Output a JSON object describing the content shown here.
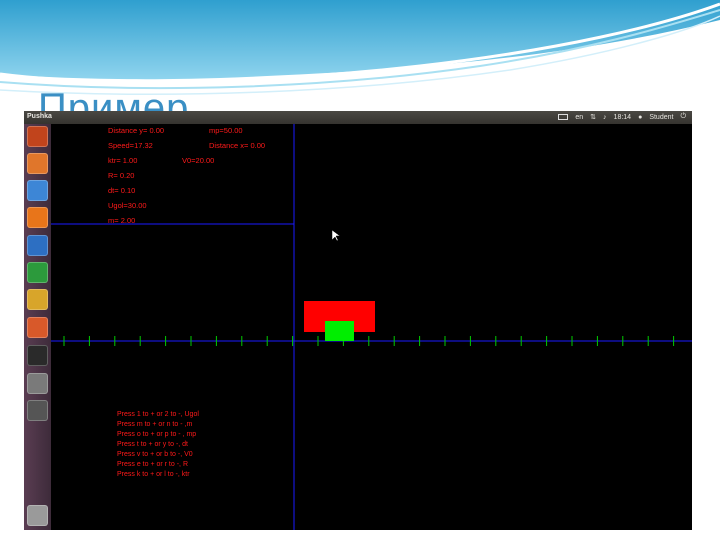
{
  "slide": {
    "title": "Пример"
  },
  "window": {
    "app_name": "Pushka",
    "keyboard_layout": "en",
    "time": "18:14",
    "user": "Student"
  },
  "launcher": {
    "items": [
      {
        "icon": "ubuntu-dash-icon",
        "color": "#c1441c"
      },
      {
        "icon": "home-folder-icon",
        "color": "#e0762b"
      },
      {
        "icon": "chromium-icon",
        "color": "#3d86d6"
      },
      {
        "icon": "firefox-icon",
        "color": "#e8751a"
      },
      {
        "icon": "writer-icon",
        "color": "#2d6fc2"
      },
      {
        "icon": "calc-icon",
        "color": "#2c9a3c"
      },
      {
        "icon": "app-icon",
        "color": "#d8a52a"
      },
      {
        "icon": "impress-icon",
        "color": "#d8592a"
      },
      {
        "icon": "terminal-icon",
        "color": "#2a2a2a"
      },
      {
        "icon": "help-icon",
        "color": "#7a7a7a"
      },
      {
        "icon": "window-icon",
        "color": "#555555"
      },
      {
        "icon": "trash-icon",
        "color": "#9a9a9a"
      }
    ]
  },
  "simulation": {
    "info": {
      "distance_y": "Distance y= 0.00",
      "mp": "mp=50.00",
      "speed": "Speed=17.32",
      "distance_x": "Distance x= 0.00",
      "ktr": "ktr= 1.00",
      "v0": "V0=20.00",
      "r": "R= 0.20",
      "dt": "dt= 0.10",
      "ugol": "Ugol=30.00",
      "m": "m= 2.00"
    },
    "help": [
      "Press 1 to + or 2 to -, Ugol",
      "Press m to + or n to - ,m",
      "Press o to + or p to - , mp",
      "Press t to + or y to -, dt",
      "Press v to + or b to -, V0",
      "Press e to + or r to -, R",
      "Press k to + or l to -, ktr"
    ],
    "colors": {
      "axis": "#1a1aff",
      "tick": "#00cc00",
      "text": "#ff1a1a",
      "cannon": "#ff0000",
      "projectile": "#00ee00"
    }
  }
}
